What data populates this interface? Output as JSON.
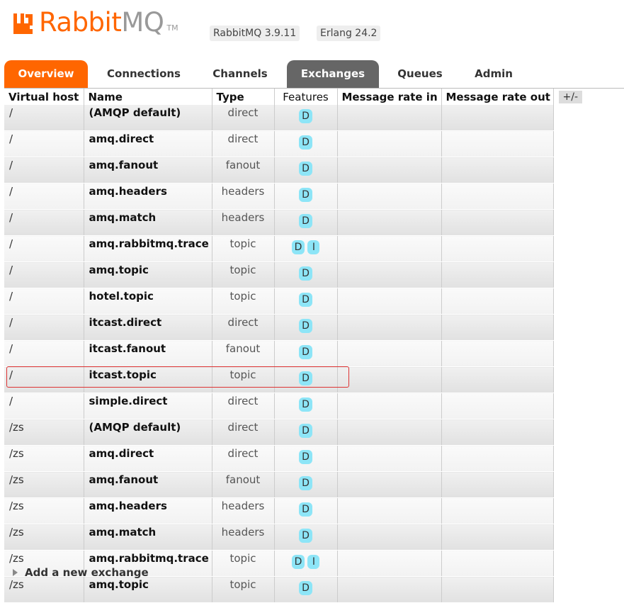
{
  "header": {
    "logo_rabbit": "Rabbit",
    "logo_mq": "MQ",
    "trademark": "TM",
    "rabbitmq_version": "RabbitMQ 3.9.11",
    "erlang_version": "Erlang 24.2"
  },
  "tabs": [
    {
      "label": "Overview"
    },
    {
      "label": "Connections"
    },
    {
      "label": "Channels"
    },
    {
      "label": "Exchanges",
      "active": true
    },
    {
      "label": "Queues"
    },
    {
      "label": "Admin"
    }
  ],
  "table": {
    "columns": [
      "Virtual host",
      "Name",
      "Type",
      "Features",
      "Message rate in",
      "Message rate out"
    ],
    "plus_minus": "+/-",
    "rows": [
      {
        "vhost": "/",
        "name": "(AMQP default)",
        "type": "direct",
        "features": [
          "D"
        ]
      },
      {
        "vhost": "/",
        "name": "amq.direct",
        "type": "direct",
        "features": [
          "D"
        ]
      },
      {
        "vhost": "/",
        "name": "amq.fanout",
        "type": "fanout",
        "features": [
          "D"
        ]
      },
      {
        "vhost": "/",
        "name": "amq.headers",
        "type": "headers",
        "features": [
          "D"
        ]
      },
      {
        "vhost": "/",
        "name": "amq.match",
        "type": "headers",
        "features": [
          "D"
        ]
      },
      {
        "vhost": "/",
        "name": "amq.rabbitmq.trace",
        "type": "topic",
        "features": [
          "D",
          "I"
        ]
      },
      {
        "vhost": "/",
        "name": "amq.topic",
        "type": "topic",
        "features": [
          "D"
        ]
      },
      {
        "vhost": "/",
        "name": "hotel.topic",
        "type": "topic",
        "features": [
          "D"
        ]
      },
      {
        "vhost": "/",
        "name": "itcast.direct",
        "type": "direct",
        "features": [
          "D"
        ]
      },
      {
        "vhost": "/",
        "name": "itcast.fanout",
        "type": "fanout",
        "features": [
          "D"
        ]
      },
      {
        "vhost": "/",
        "name": "itcast.topic",
        "type": "topic",
        "features": [
          "D"
        ]
      },
      {
        "vhost": "/",
        "name": "simple.direct",
        "type": "direct",
        "features": [
          "D"
        ]
      },
      {
        "vhost": "/zs",
        "name": "(AMQP default)",
        "type": "direct",
        "features": [
          "D"
        ]
      },
      {
        "vhost": "/zs",
        "name": "amq.direct",
        "type": "direct",
        "features": [
          "D"
        ]
      },
      {
        "vhost": "/zs",
        "name": "amq.fanout",
        "type": "fanout",
        "features": [
          "D"
        ]
      },
      {
        "vhost": "/zs",
        "name": "amq.headers",
        "type": "headers",
        "features": [
          "D"
        ]
      },
      {
        "vhost": "/zs",
        "name": "amq.match",
        "type": "headers",
        "features": [
          "D"
        ]
      },
      {
        "vhost": "/zs",
        "name": "amq.rabbitmq.trace",
        "type": "topic",
        "features": [
          "D",
          "I"
        ]
      },
      {
        "vhost": "/zs",
        "name": "amq.topic",
        "type": "topic",
        "features": [
          "D"
        ]
      }
    ]
  },
  "add_exchange": {
    "label": "Add a new exchange"
  },
  "colors": {
    "brand_orange": "#ff6600",
    "active_tab": "#666666",
    "feature_badge": "#8de5f7",
    "highlight_box": "#dd3333"
  }
}
